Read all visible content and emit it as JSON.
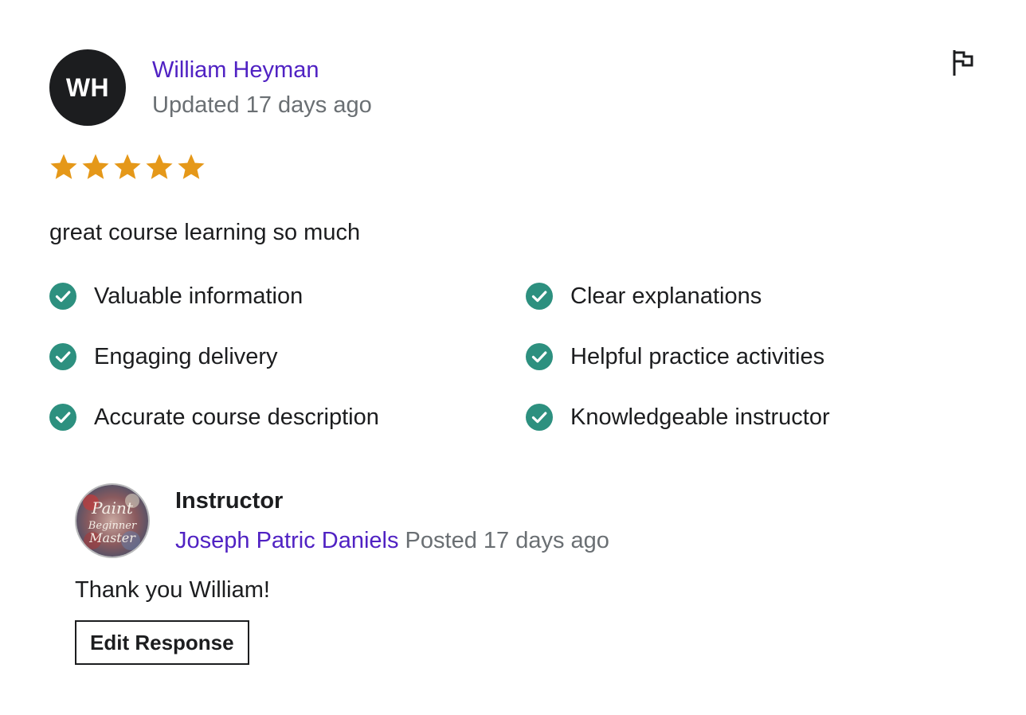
{
  "review": {
    "avatar_initials": "WH",
    "reviewer_name": "William Heyman",
    "updated": "Updated 17 days ago",
    "rating": 5,
    "rating_max": 5,
    "comment": "great course learning so much",
    "star_color": "#e59819",
    "flag_icon": "flag-icon",
    "tags": [
      "Valuable information",
      "Clear explanations",
      "Engaging delivery",
      "Helpful practice activities",
      "Accurate course description",
      "Knowledgeable instructor"
    ],
    "check_color": "#2d907f"
  },
  "response": {
    "role": "Instructor",
    "instructor_name": "Joseph Patric Daniels",
    "posted": "Posted 17 days ago",
    "message": "Thank you William!",
    "avatar_text": [
      "Paint",
      "Beginner",
      "Master"
    ],
    "edit_label": "Edit Response"
  },
  "colors": {
    "link": "#5022c3",
    "muted": "#6a6f73",
    "text": "#1c1d1f"
  }
}
